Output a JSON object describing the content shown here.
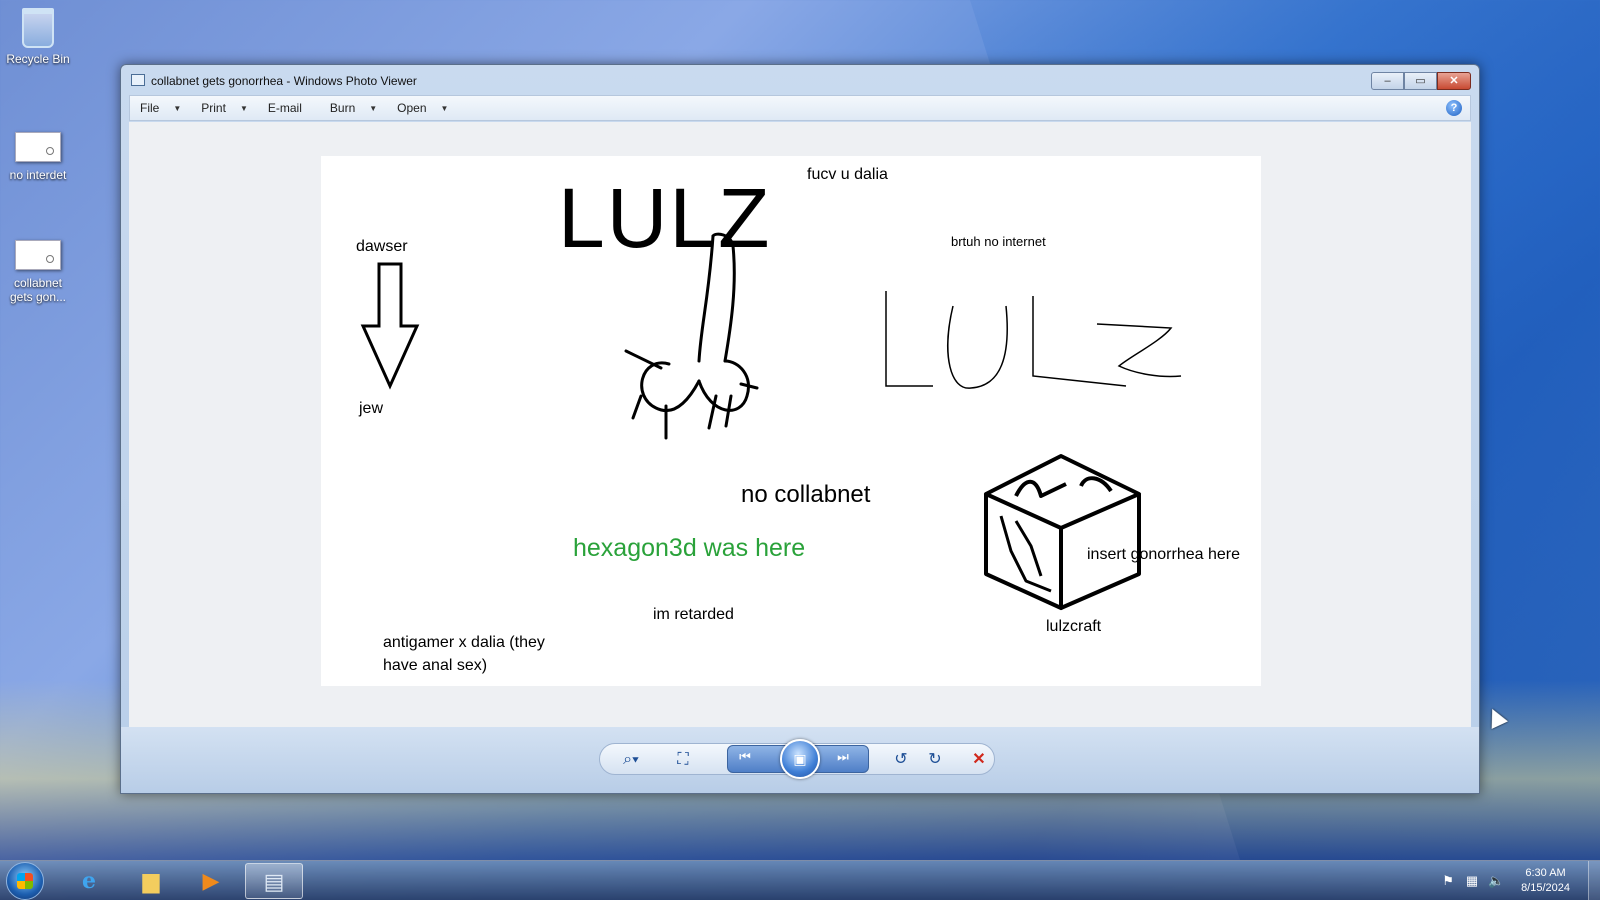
{
  "desktop": {
    "icons": [
      {
        "label": "Recycle Bin"
      },
      {
        "label": "no interdet"
      },
      {
        "label": "collabnet gets gon..."
      }
    ]
  },
  "window": {
    "title": "collabnet gets gonorrhea - Windows Photo Viewer",
    "buttons": {
      "minimize": "–",
      "maximize": "▭",
      "close": "✕"
    },
    "menu": [
      {
        "label": "File",
        "dropdown": "▼"
      },
      {
        "label": "Print",
        "dropdown": "▼"
      },
      {
        "label": "E-mail",
        "dropdown": ""
      },
      {
        "label": "Burn",
        "dropdown": "▼"
      },
      {
        "label": "Open",
        "dropdown": "▼"
      }
    ],
    "help": "?"
  },
  "photo": {
    "texts": {
      "lulz_big": "LULZ",
      "fucv": "fucv u  dalia",
      "dawser": "dawser",
      "jew": "jew",
      "brtuh": "brtuh no internet",
      "no_collabnet": "no collabnet",
      "hexagon": "hexagon3d was here",
      "insert": "insert gonorrhea  here",
      "retarded": "im retarded",
      "lulzcraft": "lulzcraft",
      "antigamer_line1": "antigamer x dalia (they",
      "antigamer_line2": "have anal sex)"
    },
    "colors": {
      "hexagon_text": "#2aa23a"
    }
  },
  "toolbar": {
    "zoom": "⌕▾",
    "fit": "⛶",
    "prev": "⏮",
    "slideshow": "▣",
    "next": "⏭",
    "rotate_ccw": "↺",
    "rotate_cw": "↻",
    "delete": "✕"
  },
  "taskbar": {
    "apps": [
      {
        "name": "internet-explorer",
        "glyph": "e"
      },
      {
        "name": "file-explorer",
        "glyph": "▆"
      },
      {
        "name": "media-player",
        "glyph": "▶"
      },
      {
        "name": "photo-viewer",
        "glyph": "▤"
      }
    ],
    "clock": {
      "time": "6:30 AM",
      "date": "8/15/2024"
    },
    "tray": {
      "flag": "⚑",
      "network": "▦",
      "volume": "🔈"
    }
  }
}
